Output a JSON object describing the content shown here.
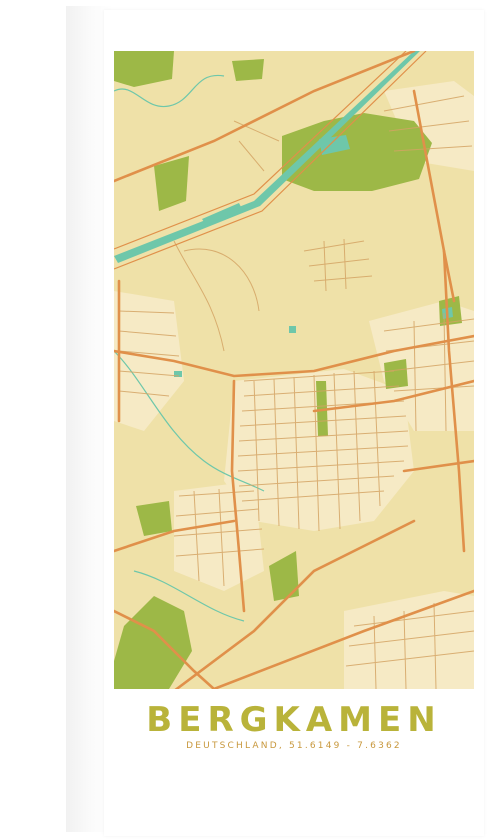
{
  "poster": {
    "city": "BERGKAMEN",
    "coordinates": "DEUTSCHLAND, 51.6149 - 7.6362"
  },
  "colors": {
    "land": "#efe1a8",
    "urban": "#f6eac5",
    "major_road": "#e0904a",
    "minor_road": "#d4a464",
    "green": "#9db847",
    "water": "#6ec7aa",
    "title": "#b9b33a",
    "coordinates": "#c8983d"
  }
}
